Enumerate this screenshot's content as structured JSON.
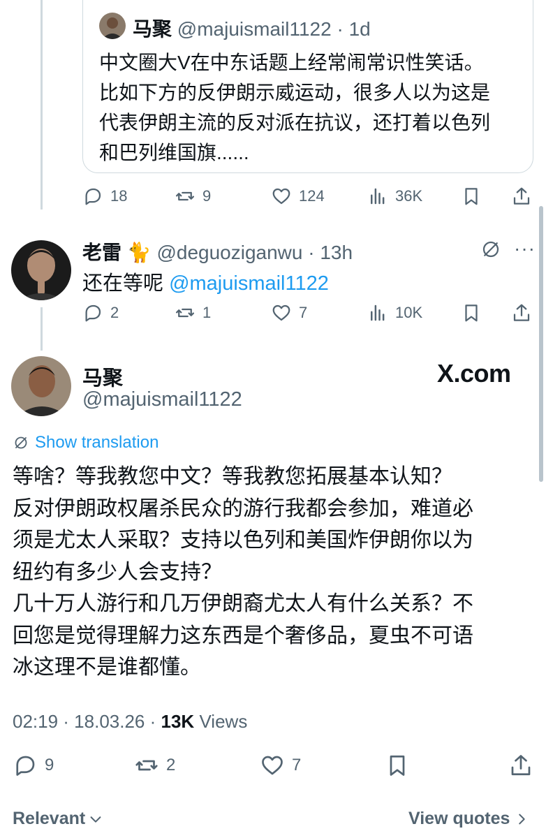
{
  "quoted_tweet": {
    "name": "马聚",
    "handle": "@majuismail1122",
    "time": "1d",
    "text_lines": [
      "中文圈大V在中东话题上经常闹常识性笑话。",
      "比如下方的反伊朗示威运动，很多人以为这是",
      "代表伊朗主流的反对派在抗议，还打着以色列",
      "和巴列维国旗......"
    ],
    "replies": "18",
    "reposts": "9",
    "likes": "124",
    "views": "36K"
  },
  "reply_tweet": {
    "name": "老雷",
    "emoji": "🐈",
    "handle": "@deguoziganwu",
    "time": "13h",
    "text": "还在等呢",
    "mention": "@majuismail1122",
    "replies": "2",
    "reposts": "1",
    "likes": "7",
    "views": "10K"
  },
  "main_tweet": {
    "name": "马聚",
    "handle": "@majuismail1122",
    "watermark": "X.com",
    "show_translation": "Show translation",
    "text_lines": [
      "等啥？等我教您中文？等我教您拓展基本认知？",
      "反对伊朗政权屠杀民众的游行我都会参加，难道必",
      "须是尤太人采取？支持以色列和美国炸伊朗你以为",
      "纽约有多少人会支持？",
      "几十万人游行和几万伊朗裔尤太人有什么关系？不",
      "回您是觉得理解力这东西是个奢侈品，夏虫不可语",
      "冰这理不是谁都懂。"
    ],
    "timestamp": "02:19 · 18.03.26 ·",
    "views_count": "13K",
    "views_label": "Views",
    "replies": "9",
    "reposts": "2",
    "likes": "7"
  },
  "footer": {
    "sort_label": "Relevant",
    "view_quotes": "View quotes"
  },
  "colors": {
    "text": "#0f1419",
    "secondary": "#536471",
    "link": "#1d9bf0",
    "border": "#cfd9de"
  }
}
